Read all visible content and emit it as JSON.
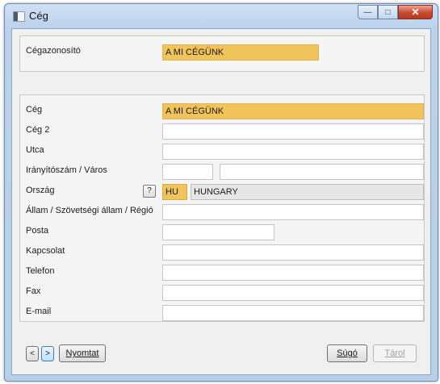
{
  "window": {
    "title": "Cég"
  },
  "header": {
    "label": "Cégazonosító",
    "value": "A MI CÉGÜNK"
  },
  "form": {
    "company_label": "Cég",
    "company_value": "A MI CÉGÜNK",
    "company2_label": "Cég 2",
    "company2_value": "",
    "street_label": "Utca",
    "street_value": "",
    "zip_city_label": "Irányítószám / Város",
    "zip_value": "",
    "city_value": "",
    "country_label": "Ország",
    "country_help": "?",
    "country_code": "HU",
    "country_name": "HUNGARY",
    "state_label": "Állam / Szövetségi állam / Régió",
    "state_value": "",
    "pobox_label": "Posta",
    "pobox_value": "",
    "contact_label": "Kapcsolat",
    "contact_value": "",
    "phone_label": "Telefon",
    "phone_value": "",
    "fax_label": "Fax",
    "fax_value": "",
    "email_label": "E-mail",
    "email_value": ""
  },
  "footer": {
    "prev": "<",
    "next": ">",
    "print_label": "Nyomtat",
    "help_label": "Súgó",
    "save_label": "Tárol"
  },
  "colors": {
    "highlight": "#f0c45a",
    "readonly": "#e6e6e6"
  }
}
